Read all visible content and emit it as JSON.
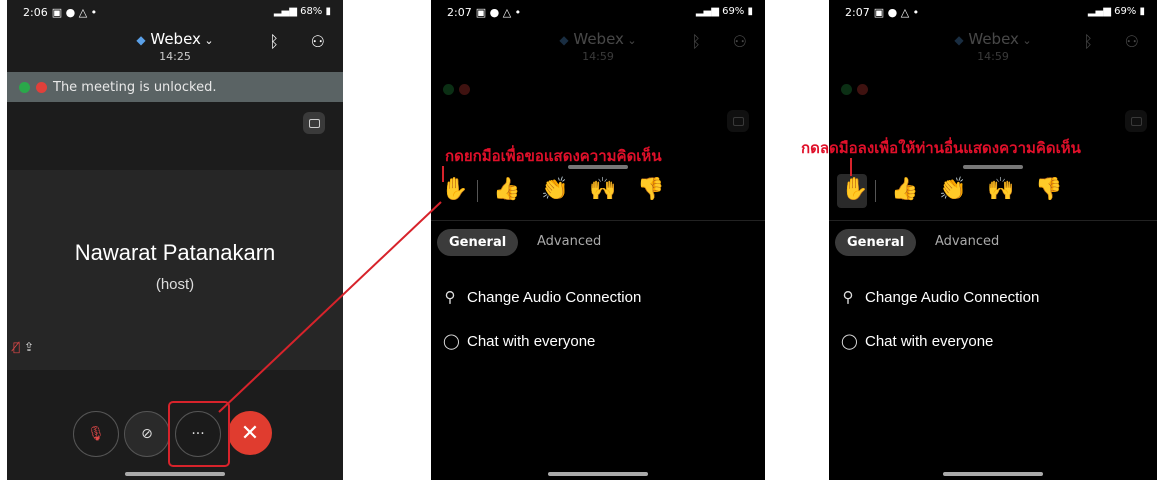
{
  "screen1": {
    "status": {
      "time": "2:06",
      "right": "68%"
    },
    "header": {
      "title": "Webex",
      "subtitle": "14:25"
    },
    "banner": "The meeting is unlocked.",
    "participant": {
      "name": "Nawarat Patanakarn",
      "role": "(host)"
    },
    "controls": {
      "more_label": "···",
      "end_label": "✕"
    }
  },
  "screen2": {
    "status": {
      "time": "2:07",
      "right": "69%"
    },
    "header": {
      "title": "Webex",
      "subtitle": "14:59"
    },
    "annotation": "กดยกมือเพื่อขอแสดงความคิดเห็น",
    "tabs": [
      "General",
      "Advanced"
    ],
    "menu": [
      "Change Audio Connection",
      "Chat with everyone"
    ]
  },
  "screen3": {
    "status": {
      "time": "2:07",
      "right": "69%"
    },
    "header": {
      "title": "Webex",
      "subtitle": "14:59"
    },
    "annotation": "กดลดมือลงเพื่อให้ท่านอื่นแสดงความคิดเห็น",
    "tabs": [
      "General",
      "Advanced"
    ],
    "menu": [
      "Change Audio Connection",
      "Chat with everyone"
    ]
  },
  "reactions": [
    "👍",
    "👏",
    "🙌",
    "👎",
    "😊",
    "😄"
  ],
  "colors": {
    "annotation": "#d7232b",
    "end_call": "#e03c2f",
    "banner": "#5a6364"
  }
}
